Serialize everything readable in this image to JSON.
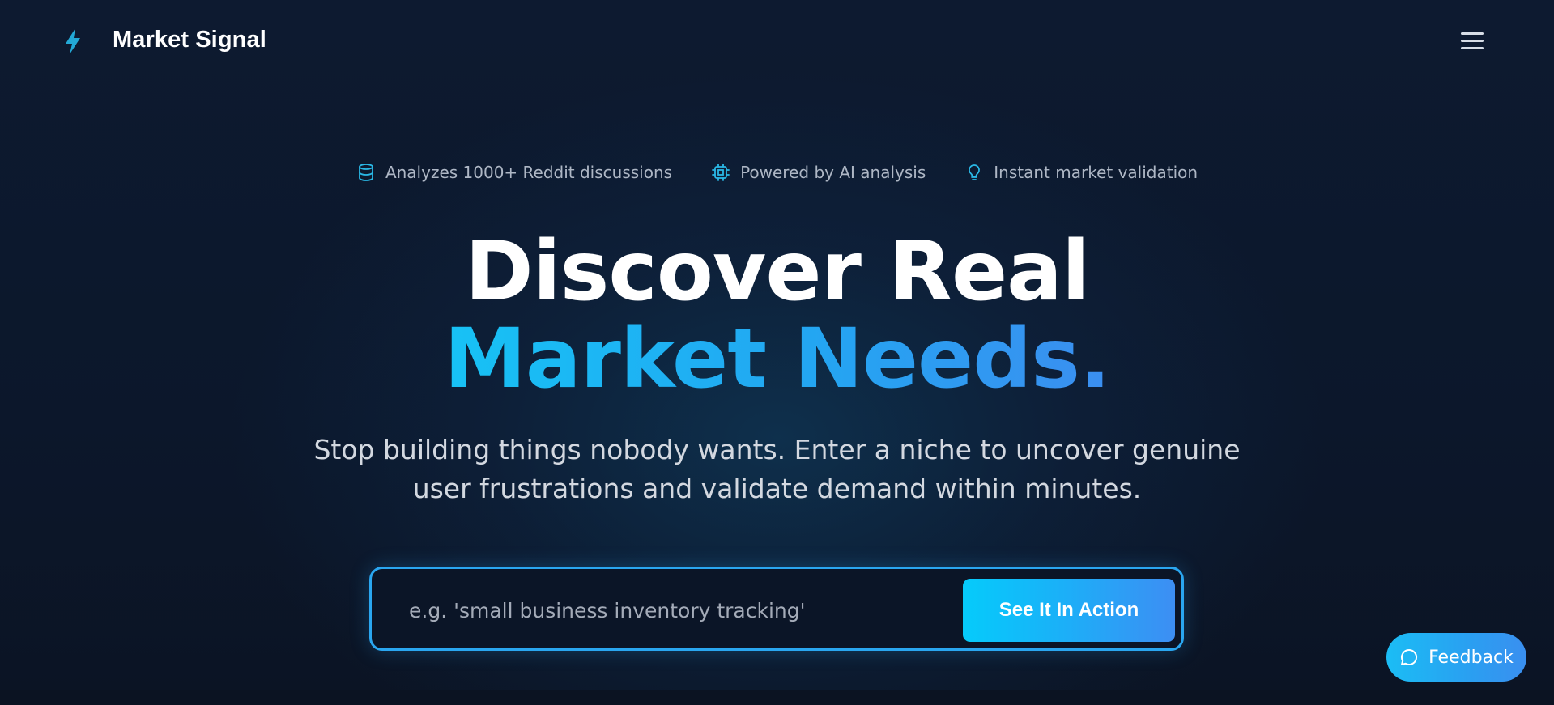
{
  "header": {
    "brand": "Market Signal",
    "logo_icon": "lightning-bolt-icon",
    "menu_icon": "hamburger-menu-icon"
  },
  "features": [
    {
      "icon": "database-icon",
      "label": "Analyzes 1000+ Reddit discussions"
    },
    {
      "icon": "cpu-chip-icon",
      "label": "Powered by AI analysis"
    },
    {
      "icon": "lightbulb-icon",
      "label": "Instant market validation"
    }
  ],
  "hero": {
    "title_line1": "Discover Real",
    "title_line2": "Market Needs.",
    "subtitle": "Stop building things nobody wants. Enter a niche to uncover genuine user frustrations and validate demand within minutes."
  },
  "search": {
    "placeholder": "e.g. 'small business inventory tracking'",
    "value": "",
    "button_label": "See It In Action"
  },
  "feedback": {
    "label": "Feedback",
    "icon": "chat-bubble-icon"
  },
  "colors": {
    "accent_cyan": "#17c2f5",
    "accent_blue": "#3b8ef0",
    "background": "#0c172b",
    "feature_icon": "#2ab8e6"
  }
}
